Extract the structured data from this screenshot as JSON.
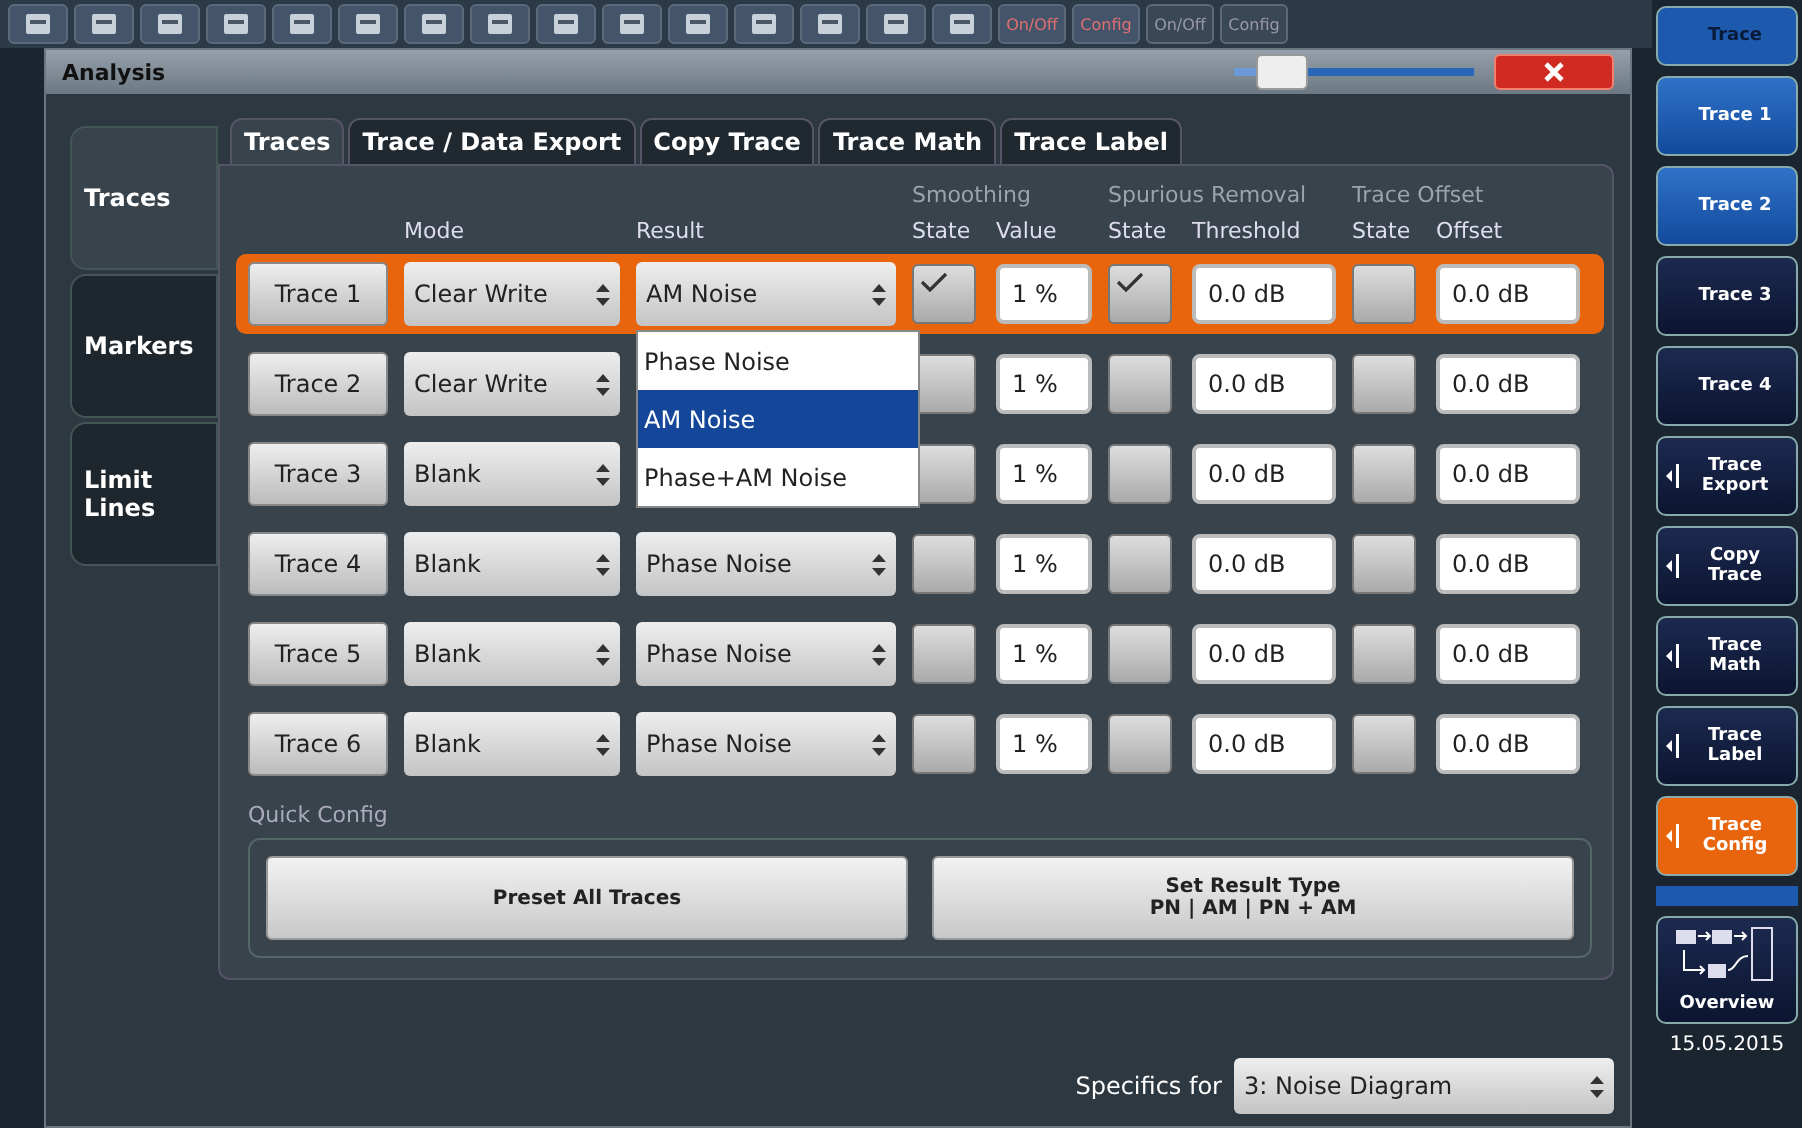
{
  "toolbar": {
    "toggles": [
      {
        "label": "On/Off",
        "enabled": true
      },
      {
        "label": "Config",
        "enabled": true
      },
      {
        "label": "On/Off",
        "enabled": false
      },
      {
        "label": "Config",
        "enabled": false
      }
    ]
  },
  "dialog": {
    "title": "Analysis",
    "transparency": {
      "level": 0.12
    },
    "side_tabs": [
      {
        "label": "Traces",
        "selected": true
      },
      {
        "label": "Markers",
        "selected": false
      },
      {
        "label": "Limit Lines",
        "selected": false
      }
    ],
    "tabs": [
      {
        "label": "Traces",
        "selected": true
      },
      {
        "label": "Trace / Data Export",
        "selected": false
      },
      {
        "label": "Copy Trace",
        "selected": false
      },
      {
        "label": "Trace Math",
        "selected": false
      },
      {
        "label": "Trace Label",
        "selected": false
      }
    ],
    "groups": [
      "Smoothing",
      "Spurious Removal",
      "Trace Offset"
    ],
    "columns": [
      "Mode",
      "Result",
      "State",
      "Value",
      "State",
      "Threshold",
      "State",
      "Offset"
    ],
    "rows": [
      {
        "trace": "Trace 1",
        "mode": "Clear Write",
        "result": "AM Noise",
        "smoothing": true,
        "smoothing_value": "1 %",
        "spur": true,
        "threshold": "0.0 dB",
        "offset_on": false,
        "offset": "0.0 dB",
        "selected": true,
        "dropdown": [
          {
            "label": "Phase Noise",
            "selected": false
          },
          {
            "label": "AM Noise",
            "selected": true
          },
          {
            "label": "Phase+AM Noise",
            "selected": false
          }
        ]
      },
      {
        "trace": "Trace 2",
        "mode": "Clear Write",
        "smoothing": false,
        "smoothing_value": "1 %",
        "spur": false,
        "threshold": "0.0 dB",
        "offset_on": false,
        "offset": "0.0 dB",
        "selected": false
      },
      {
        "trace": "Trace 3",
        "mode": "Blank",
        "smoothing": false,
        "smoothing_value": "1 %",
        "spur": false,
        "threshold": "0.0 dB",
        "offset_on": false,
        "offset": "0.0 dB",
        "selected": false
      },
      {
        "trace": "Trace 4",
        "mode": "Blank",
        "result": "Phase Noise",
        "smoothing": false,
        "smoothing_value": "1 %",
        "spur": false,
        "threshold": "0.0 dB",
        "offset_on": false,
        "offset": "0.0 dB",
        "selected": false
      },
      {
        "trace": "Trace 5",
        "mode": "Blank",
        "result": "Phase Noise",
        "smoothing": false,
        "smoothing_value": "1 %",
        "spur": false,
        "threshold": "0.0 dB",
        "offset_on": false,
        "offset": "0.0 dB",
        "selected": false
      },
      {
        "trace": "Trace 6",
        "mode": "Blank",
        "result": "Phase Noise",
        "smoothing": false,
        "smoothing_value": "1 %",
        "spur": false,
        "threshold": "0.0 dB",
        "offset_on": false,
        "offset": "0.0 dB",
        "selected": false
      }
    ],
    "quick_config": {
      "title": "Quick Config",
      "buttons": [
        {
          "label": "Preset All Traces"
        },
        {
          "label": "Set Result Type",
          "sublabel": "PN | AM | PN + AM"
        }
      ]
    },
    "specifics": {
      "label": "Specifics for",
      "value": "3: Noise Diagram"
    }
  },
  "softkeys": [
    {
      "label": "Trace",
      "kind": "header"
    },
    {
      "label": "Trace 1",
      "kind": "toggle",
      "on": true
    },
    {
      "label": "Trace 2",
      "kind": "toggle",
      "on": true
    },
    {
      "label": "Trace 3",
      "kind": "toggle",
      "on": false
    },
    {
      "label": "Trace 4",
      "kind": "toggle",
      "on": false
    },
    {
      "label": "Trace Export",
      "kind": "submenu",
      "selected": false
    },
    {
      "label": "Copy Trace",
      "kind": "submenu",
      "selected": false
    },
    {
      "label": "Trace Math",
      "kind": "submenu",
      "selected": false
    },
    {
      "label": "Trace Label",
      "kind": "submenu",
      "selected": false
    },
    {
      "label": "Trace Config",
      "kind": "submenu",
      "selected": true
    }
  ],
  "overview": {
    "label": "Overview"
  },
  "date": "15.05.2015"
}
